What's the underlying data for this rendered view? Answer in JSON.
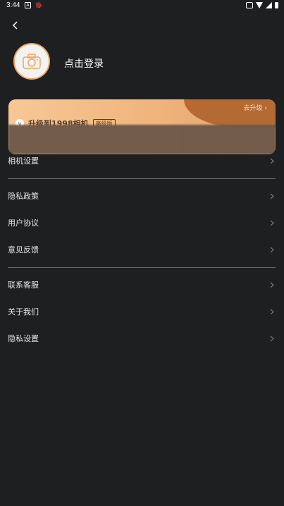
{
  "status_bar": {
    "time": "3:44",
    "notif_icons": [
      "notification-icon",
      "bug-icon"
    ],
    "right_icons": [
      "vibrate-icon",
      "wifi-icon",
      "signal-icon",
      "battery-icon"
    ]
  },
  "header": {
    "back_icon": "chevron-left-icon",
    "login_label": "点击登录",
    "avatar_icon": "camera-icon"
  },
  "upgrade_card": {
    "go_label": "去升级 ›",
    "title": "升级到1998相机",
    "tag": "高级版"
  },
  "menu": {
    "camera_settings": "相机设置",
    "privacy_policy": "隐私政策",
    "user_agreement": "用户协议",
    "feedback": "意见反馈",
    "contact_support": "联系客服",
    "about_us": "关于我们",
    "privacy_settings": "隐私设置"
  },
  "colors": {
    "background": "#1e1f21",
    "accent": "#f0a45f",
    "card_gradient_start": "#f6c896",
    "card_gradient_end": "#e3a06a",
    "card_dark": "#b66a33",
    "divider": "#6a6a6a"
  }
}
